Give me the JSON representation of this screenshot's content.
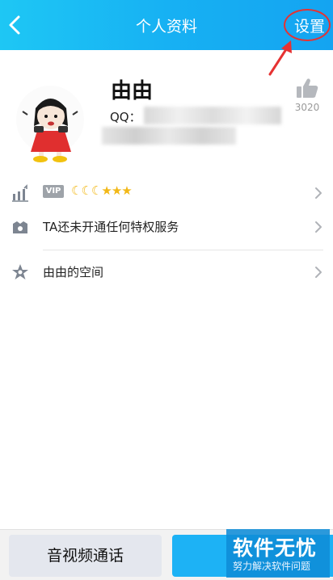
{
  "header": {
    "title": "个人资料",
    "settings_label": "设置",
    "back_icon": "chevron-left-icon",
    "background": "#17b1f3"
  },
  "annotation": {
    "highlight_color": "#e63232"
  },
  "profile": {
    "name": "由由",
    "qq_label": "QQ：",
    "like_count": "3020",
    "like_icon": "thumbs-up-icon"
  },
  "rows": [
    {
      "icon": "level-chart-icon",
      "vip_badge": "VIP",
      "level": {
        "moons": 3,
        "stars": 3
      }
    },
    {
      "icon": "privilege-icon",
      "label": "TA还未开通任何特权服务"
    },
    {
      "icon": "star-space-icon",
      "label": "由由的空间"
    }
  ],
  "bottom": {
    "call_button": "音视频通话"
  },
  "watermark": {
    "main": "软件无忧",
    "sub": "努力解决软件问题"
  }
}
